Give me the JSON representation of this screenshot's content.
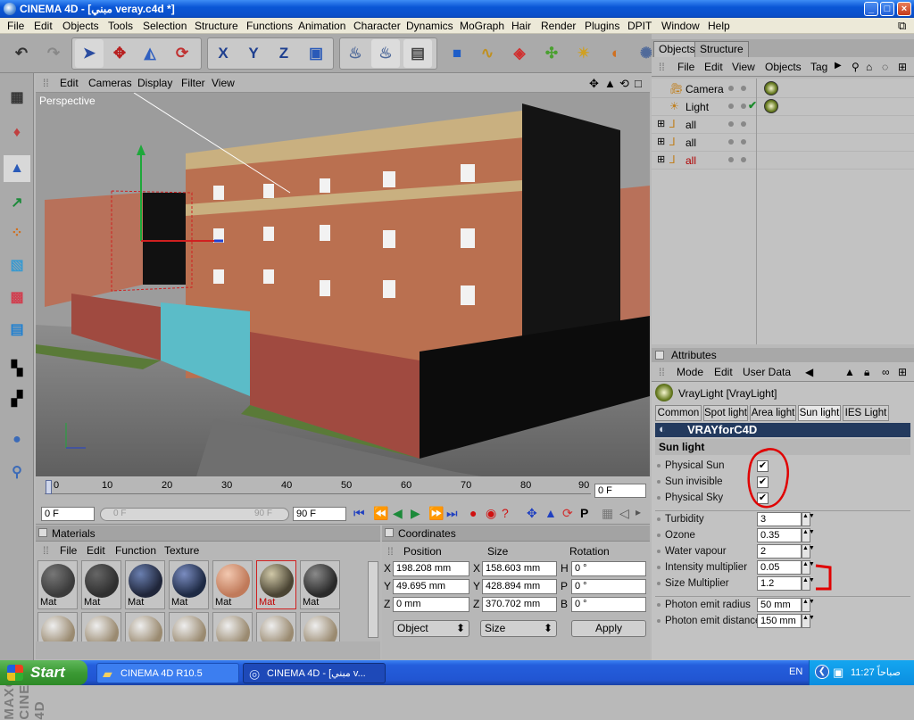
{
  "window": {
    "title": "CINEMA 4D - [مبني veray.c4d *]",
    "min": "_",
    "max": "□",
    "close": "×"
  },
  "menu": [
    "File",
    "Edit",
    "Objects",
    "Tools",
    "Selection",
    "Structure",
    "Functions",
    "Animation",
    "Character",
    "Dynamics",
    "MoGraph",
    "Hair",
    "Render",
    "Plugins",
    "DPIT",
    "Window",
    "Help"
  ],
  "viewport": {
    "menu": [
      "Edit",
      "Cameras",
      "Display",
      "Filter",
      "View"
    ],
    "label": "Perspective"
  },
  "timeline": {
    "ticks": [
      "0",
      "10",
      "20",
      "30",
      "40",
      "50",
      "60",
      "70",
      "80",
      "90"
    ],
    "current_frame": "0 F",
    "start": "0 F",
    "slider_start": "0 F",
    "slider_end": "90 F",
    "end": "90 F"
  },
  "materials": {
    "title": "Materials",
    "menu": [
      "File",
      "Edit",
      "Function",
      "Texture"
    ],
    "items": [
      {
        "label": "Mat",
        "color": "#3b3b3b",
        "highlight": "#777",
        "selected": false
      },
      {
        "label": "Mat",
        "color": "#2f2f2f",
        "highlight": "#666",
        "selected": false
      },
      {
        "label": "Mat",
        "color": "#20263a",
        "highlight": "#6a7fb0",
        "selected": false
      },
      {
        "label": "Mat",
        "color": "#1e2a44",
        "highlight": "#7a8cc0",
        "selected": false
      },
      {
        "label": "Mat",
        "color": "#c07a5a",
        "highlight": "#f2c8b0",
        "selected": false
      },
      {
        "label": "Mat",
        "color": "#4a4433",
        "highlight": "#d0c8a8",
        "selected": true
      },
      {
        "label": "Mat",
        "color": "#2a2a2a",
        "highlight": "#8a8a8a",
        "selected": false
      }
    ]
  },
  "coordinates": {
    "title": "Coordinates",
    "headers": [
      "Position",
      "Size",
      "Rotation"
    ],
    "rows": [
      {
        "axis": "X",
        "pos": "198.208 mm",
        "size_axis": "X",
        "size": "158.603 mm",
        "rot_axis": "H",
        "rot": "0 °"
      },
      {
        "axis": "Y",
        "pos": "49.695 mm",
        "size_axis": "Y",
        "size": "428.894 mm",
        "rot_axis": "P",
        "rot": "0 °"
      },
      {
        "axis": "Z",
        "pos": "0 mm",
        "size_axis": "Z",
        "size": "370.702 mm",
        "rot_axis": "B",
        "rot": "0 °"
      }
    ],
    "mode": "Object",
    "size_mode": "Size",
    "apply": "Apply"
  },
  "objects": {
    "tabs": [
      "Objects",
      "Structure"
    ],
    "menu": [
      "File",
      "Edit",
      "View",
      "Objects",
      "Tag"
    ],
    "items": [
      {
        "name": "Camera",
        "color": "#000"
      },
      {
        "name": "Light",
        "color": "#000"
      },
      {
        "name": "all",
        "color": "#000"
      },
      {
        "name": "all",
        "color": "#000"
      },
      {
        "name": "all",
        "color": "#b00000"
      }
    ]
  },
  "attributes": {
    "title": "Attributes",
    "menu": [
      "Mode",
      "Edit",
      "User Data"
    ],
    "object": "VrayLight [VrayLight]",
    "tabs": [
      "Common",
      "Spot light",
      "Area light",
      "Sun light",
      "IES Light"
    ],
    "active_tab": "Sun light",
    "banner": "VRAYforC4D",
    "section": "Sun light",
    "checks": [
      {
        "label": "Physical Sun",
        "checked": "✔"
      },
      {
        "label": "Sun invisible",
        "checked": "✔"
      },
      {
        "label": "Physical Sky",
        "checked": "✔"
      }
    ],
    "params": [
      {
        "label": "Turbidity",
        "value": "3"
      },
      {
        "label": "Ozone",
        "value": "0.35"
      },
      {
        "label": "Water vapour",
        "value": "2"
      },
      {
        "label": "Intensity multiplier",
        "value": "0.05"
      },
      {
        "label": "Size Multiplier",
        "value": "1.2"
      }
    ],
    "photon": [
      {
        "label": "Photon emit radius",
        "value": "50 mm"
      },
      {
        "label": "Photon emit distance",
        "value": "150 mm"
      }
    ]
  },
  "taskbar": {
    "start": "Start",
    "tasks": [
      "CINEMA 4D R10.5",
      "CINEMA 4D - [مبني v..."
    ],
    "lang": "EN",
    "clock": "11:27 صباحاً"
  },
  "logo": "MAXON CINEMA 4D",
  "colors": {
    "annotation": "#e00000",
    "xp_blue": "#245edc",
    "attr_bg": "#c2c2c2"
  }
}
